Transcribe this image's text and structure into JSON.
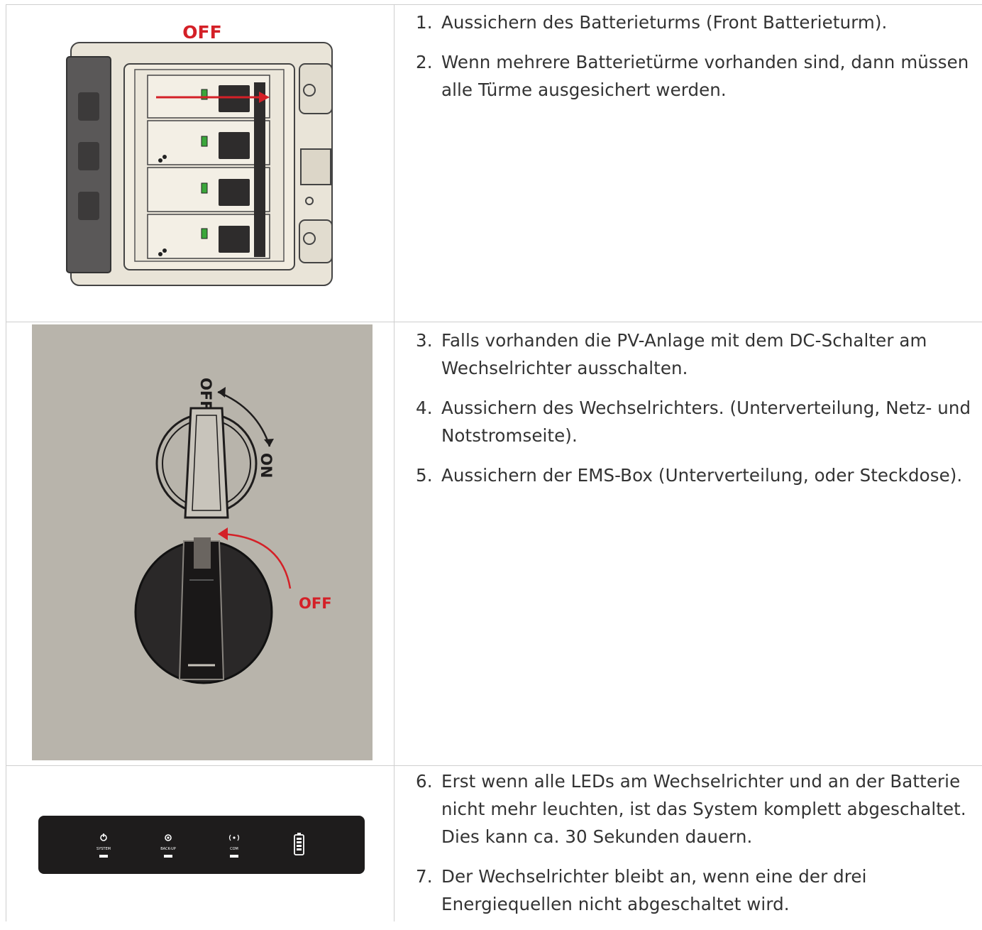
{
  "rows": [
    {
      "figure": {
        "label": "OFF"
      },
      "steps": [
        {
          "num": "1.",
          "text": "Aussichern des Batterieturms (Front Batterieturm)."
        },
        {
          "num": "2.",
          "text": "Wenn mehrere Batterietürme vorhanden sind, dann müssen alle Türme ausgesichert werden."
        }
      ]
    },
    {
      "figure": {
        "label_off_top": "OFF",
        "label_on": "ON",
        "label_off": "OFF"
      },
      "steps": [
        {
          "num": "3.",
          "text": "Falls vorhanden die PV-Anlage mit dem DC-Schalter am Wechselrichter ausschalten."
        },
        {
          "num": "4.",
          "text": "Aussichern des Wechselrichters. (Unterverteilung, Netz- und Notstromseite)."
        },
        {
          "num": "5.",
          "text": "Aussichern der EMS-Box (Unterverteilung, oder Steckdose)."
        }
      ]
    },
    {
      "figure": {
        "led_system": "SYSTEM",
        "led_backup": "BACK-UP",
        "led_com": "COM"
      },
      "steps": [
        {
          "num": "6.",
          "text": "Erst wenn alle LEDs am Wechselrichter und an der Batterie nicht mehr leuchten, ist das System komplett abgeschaltet. Dies kann ca. 30 Sekunden dauern."
        },
        {
          "num": "7.",
          "text": "Der Wechselrichter bleibt an, wenn eine der drei Energiequellen nicht abgeschaltet wird."
        }
      ]
    }
  ],
  "colors": {
    "red": "#d42027",
    "green": "#3aa63a",
    "panel_bg": "#b8b4ab",
    "dark": "#1e1c1c"
  }
}
